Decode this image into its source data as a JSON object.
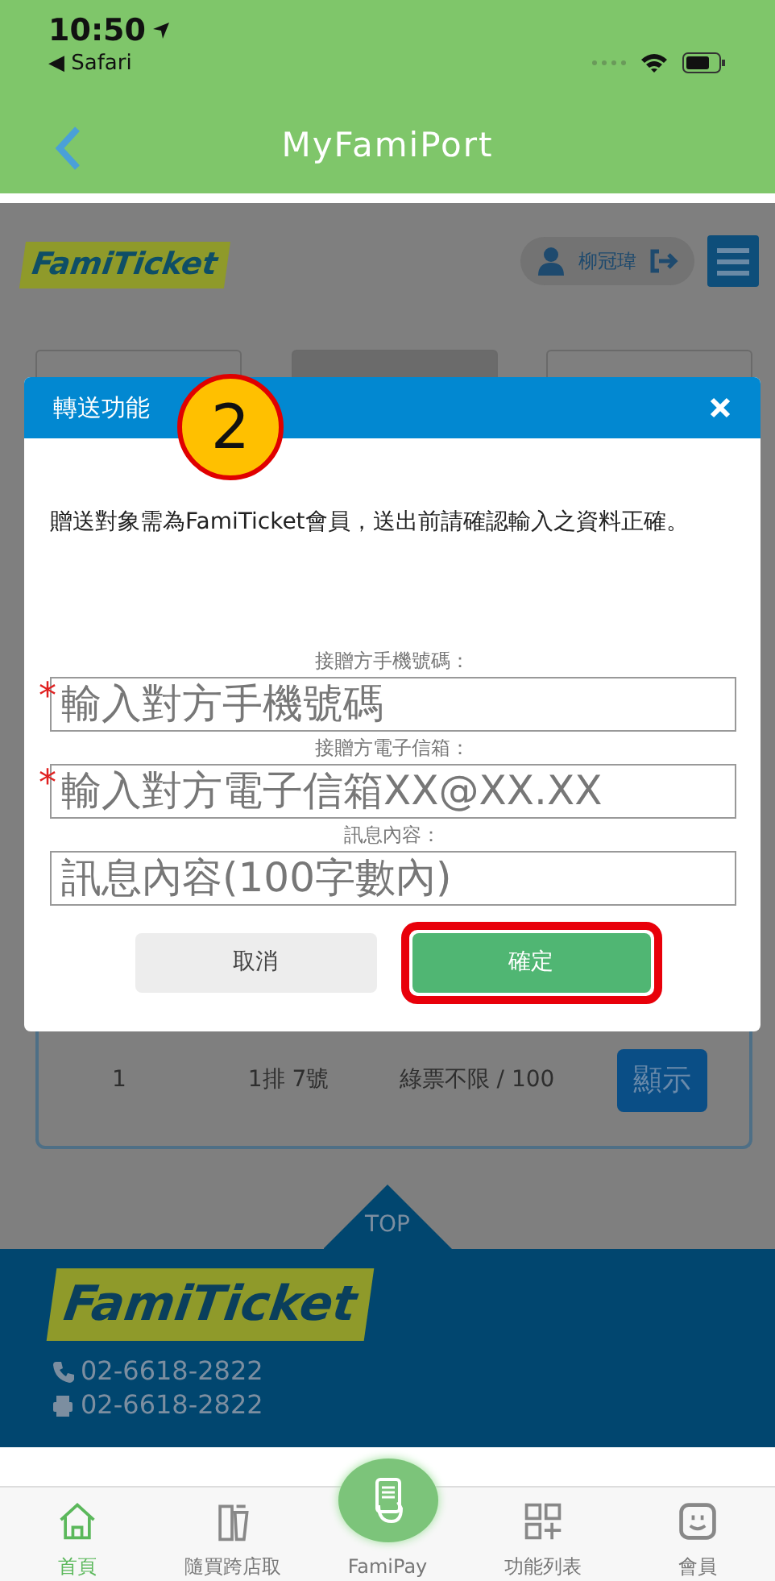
{
  "status_bar": {
    "time": "10:50",
    "back_app": "◀ Safari"
  },
  "nav_bar": {
    "title": "MyFamiPort"
  },
  "header": {
    "logo": "FamiTicket",
    "user": "柳冠瑋"
  },
  "modal": {
    "title": "轉送功能",
    "message": "贈送對象需為FamiTicket會員，送出前請確認輸入之資料正確。",
    "fields": [
      {
        "label": "接贈方手機號碼：",
        "placeholder": "輸入對方手機號碼",
        "required_mark": "*"
      },
      {
        "label": "接贈方電子信箱：",
        "placeholder": "輸入對方電子信箱XX@XX.XX",
        "required_mark": "*"
      },
      {
        "label": "訊息內容：",
        "placeholder": "訊息內容(100字數內)"
      }
    ],
    "buttons": [
      {
        "label": "取消",
        "kind": "cancel",
        "highlighted": false
      },
      {
        "label": "確定",
        "kind": "confirm",
        "highlighted": true
      }
    ]
  },
  "annotation": {
    "number": "2"
  },
  "ticket_row": {
    "cells": [
      "1",
      "1排 7號",
      "綠票不限 / 100"
    ],
    "button": "顯示"
  },
  "top_link": "TOP",
  "footer": {
    "logo": "FamiTicket",
    "phones": [
      {
        "kind": "phone",
        "number": "02-6618-2822"
      },
      {
        "kind": "fax",
        "number": "02-6618-2822"
      }
    ]
  },
  "tab_bar": [
    {
      "label": "首頁",
      "selected": true
    },
    {
      "label": "隨買跨店取",
      "selected": false
    },
    {
      "label": "FamiPay",
      "selected": false
    },
    {
      "label": "功能列表",
      "selected": false
    },
    {
      "label": "會員",
      "selected": false
    }
  ]
}
